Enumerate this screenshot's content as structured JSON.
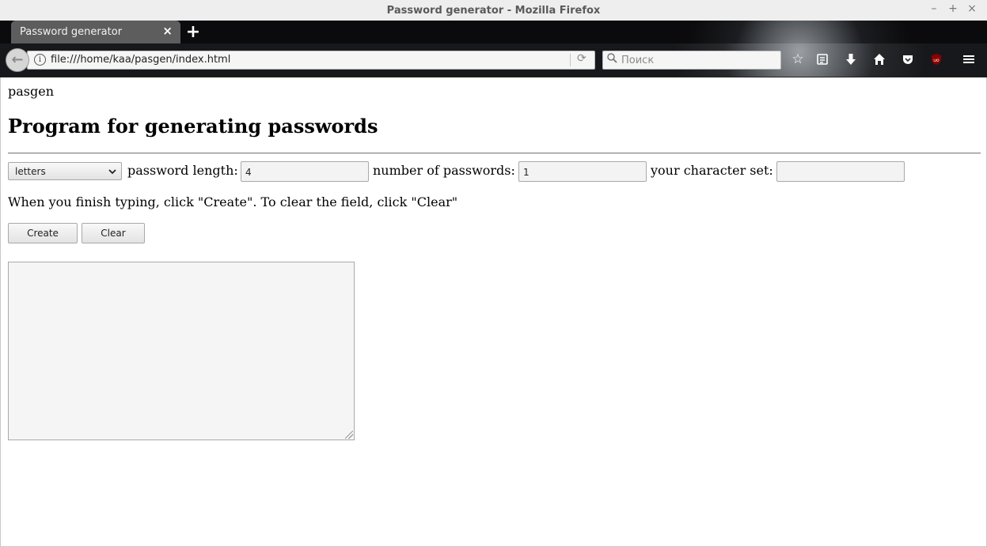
{
  "window": {
    "title": "Password generator - Mozilla Firefox",
    "controls": {
      "minimize": "–",
      "maximize": "+",
      "close": "×"
    }
  },
  "tabs": [
    {
      "label": "Password generator",
      "close": "×"
    }
  ],
  "new_tab_symbol": "+",
  "navbar": {
    "back_symbol": "←",
    "url": "file:///home/kaa/pasgen/index.html",
    "search_placeholder": "Поиск",
    "icons": [
      "bookmark-star-icon",
      "reading-list-icon",
      "download-icon",
      "home-icon",
      "pocket-icon",
      "ublock-icon",
      "hamburger-menu-icon"
    ]
  },
  "page": {
    "brand": "pasgen",
    "heading": "Program for generating passwords",
    "select": {
      "value": "letters"
    },
    "labels": {
      "length": "password length:",
      "count": "number of passwords:",
      "charset": "your character set:"
    },
    "inputs": {
      "length": "4",
      "count": "1",
      "charset": ""
    },
    "instructions": "When you finish typing, click \"Create\". To clear the field, click \"Clear\"",
    "buttons": {
      "create": "Create",
      "clear": "Clear"
    },
    "output": ""
  },
  "colors": {
    "accent_ublock": "#8b0000",
    "tab_bg": "#5d5d5d"
  }
}
